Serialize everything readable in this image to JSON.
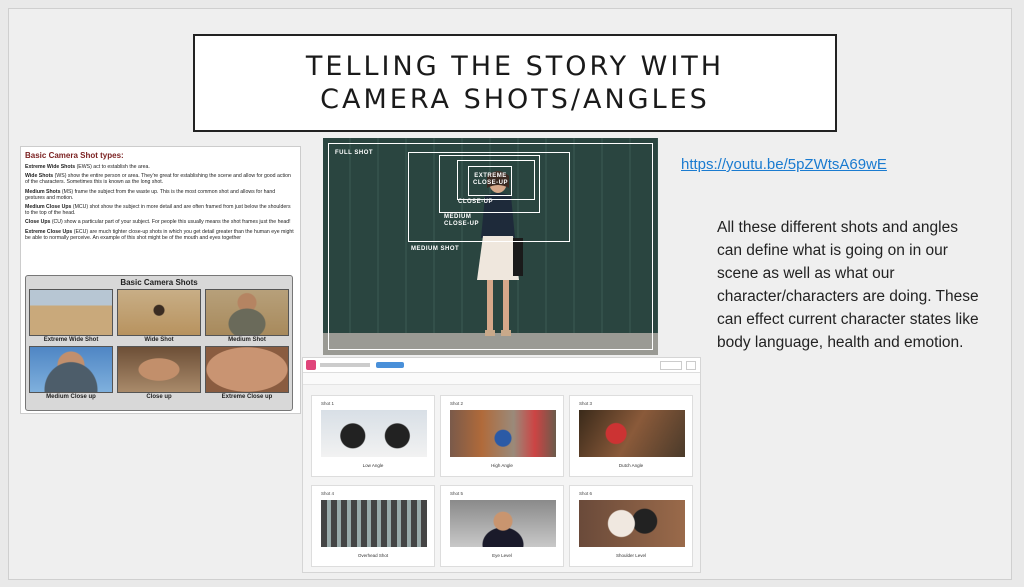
{
  "slide": {
    "title": "TELLING THE STORY WITH\nCAMERA  SHOTS/ANGLES",
    "link": "https://youtu.be/5pZWtsA69wE",
    "description": "All these different shots and angles can define what is going on in our scene as well as what our character/characters are doing. These can effect current character states like body language, health and emotion."
  },
  "handout": {
    "title": "Basic Camera Shot types:",
    "paragraphs": [
      {
        "term": "Extreme Wide Shots",
        "text": " (EWS) act to establish the area."
      },
      {
        "term": "Wide Shots",
        "text": " (WS) show the entire person or area.  They're great for establishing the scene and allow for good action of the characters.  Sometimes this is known as the long shot."
      },
      {
        "term": "Medium Shots",
        "text": " (MS) frame the subject from the waste up.  This is the most common shot and allows for hand gestures and motion."
      },
      {
        "term": "Medium Close Ups",
        "text": " (MCU) shot show the subject in more detail and are often framed from just below the shoulders to the top of the head."
      },
      {
        "term": "Close Ups",
        "text": " (CU) show a particular part of your subject.  For people this usually means the shot frames just the head!"
      },
      {
        "term": "Extreme Close Ups",
        "text": " (ECU) are much tighter close-up shots in which you get detail greater than the human eye might be able to normally perceive.  An example of this shot might be of the mouth and eyes together"
      }
    ],
    "panel_title": "Basic Camera Shots",
    "shots": [
      "Extreme Wide Shot",
      "Wide Shot",
      "Medium Shot",
      "Medium Close up",
      "Close up",
      "Extreme Close up"
    ]
  },
  "photo": {
    "labels": {
      "full": "FULL SHOT",
      "medium": "MEDIUM SHOT",
      "mcu": "MEDIUM\nCLOSE-UP",
      "cu": "CLOSE-UP",
      "ecu": "EXTREME\nCLOSE-UP"
    }
  },
  "storyboard": {
    "shots": [
      {
        "name": "Shot 1",
        "caption": "Low Angle"
      },
      {
        "name": "Shot 2",
        "caption": "High Angle"
      },
      {
        "name": "Shot 3",
        "caption": "Dutch Angle"
      },
      {
        "name": "Shot 4",
        "caption": "Overhead Shot"
      },
      {
        "name": "Shot 5",
        "caption": "Eye Level"
      },
      {
        "name": "Shot 6",
        "caption": "Shoulder Level"
      }
    ]
  },
  "colors": {
    "link": "#1a7bd0",
    "handout_title": "#7a1f1f",
    "photo_wall": "#2d4a45",
    "app_accent": "#e0457b"
  }
}
